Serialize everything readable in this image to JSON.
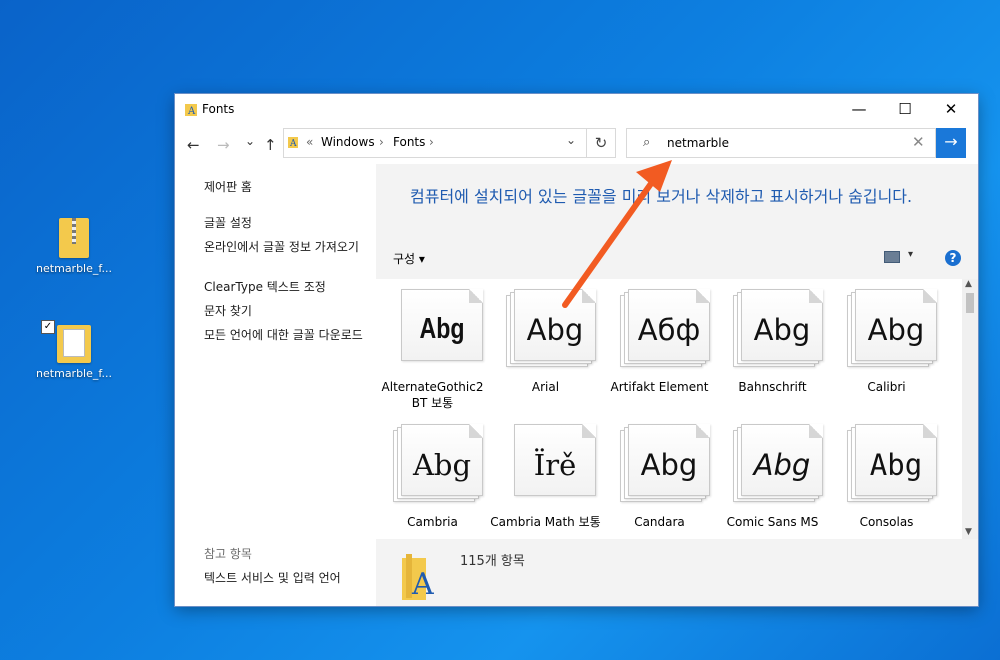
{
  "desktop": {
    "icons": [
      {
        "label": "netmarble_f...",
        "icon": "zip-folder-icon"
      },
      {
        "label": "netmarble_f...",
        "icon": "font-folder-icon"
      }
    ]
  },
  "window": {
    "title": "Fonts",
    "controls": {
      "minimize": "—",
      "maximize": "☐",
      "close": "✕"
    },
    "nav": {
      "back": "←",
      "forward": "→",
      "recent": "⌄",
      "up": "↑"
    },
    "address": {
      "sep0": "«",
      "crumbs": [
        "Windows",
        "Fonts"
      ],
      "sep": "›",
      "dropdown": "⌄",
      "refresh": "↻"
    },
    "search": {
      "value": "netmarble",
      "clear": "✕",
      "go": "→"
    },
    "left_pane": {
      "home": "제어판 홈",
      "links": [
        "글꼴 설정",
        "온라인에서 글꼴 정보 가져오기",
        "ClearType 텍스트 조정",
        "문자 찾기",
        "모든 언어에 대한 글꼴 다운로드"
      ],
      "see_also_title": "참고 항목",
      "see_also": [
        "텍스트 서비스 및 입력 언어"
      ]
    },
    "main": {
      "headline": "컴퓨터에 설치되어 있는 글꼴을 미리 보거나 삭제하고 표시하거나 숨깁니다.",
      "organize": "구성 ▾",
      "view_dropdown": "▾",
      "help": "?",
      "fonts": [
        {
          "name": "AlternateGothic2 BT 보통",
          "sample": "Abg",
          "style": "cond",
          "stack": false
        },
        {
          "name": "Arial",
          "sample": "Abg",
          "style": "sans",
          "stack": true
        },
        {
          "name": "Artifakt Element",
          "sample": "Абф",
          "style": "sans",
          "stack": true
        },
        {
          "name": "Bahnschrift",
          "sample": "Abg",
          "style": "sans",
          "stack": true
        },
        {
          "name": "Calibri",
          "sample": "Abg",
          "style": "sans",
          "stack": true
        },
        {
          "name": "Cambria",
          "sample": "Abg",
          "style": "serif",
          "stack": true
        },
        {
          "name": "Cambria Math 보통",
          "sample": "Ïrě",
          "style": "serif",
          "stack": false
        },
        {
          "name": "Candara",
          "sample": "Abg",
          "style": "sans",
          "stack": true
        },
        {
          "name": "Comic Sans MS",
          "sample": "Abg",
          "style": "it",
          "stack": true
        },
        {
          "name": "Consolas",
          "sample": "Abg",
          "style": "mono",
          "stack": true
        }
      ],
      "status_count": "115개 항목"
    },
    "annotation": {
      "color": "#f25b22"
    }
  }
}
